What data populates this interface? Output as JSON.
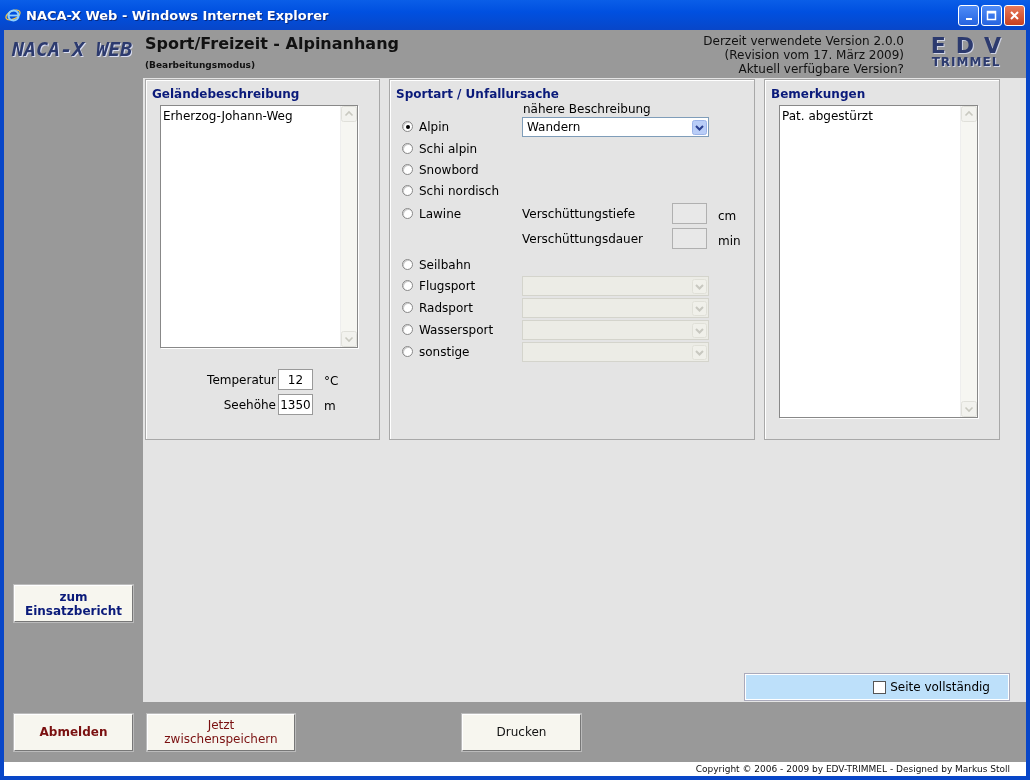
{
  "window": {
    "title": "NACA-X Web - Windows Internet Explorer"
  },
  "header": {
    "logo": "NACA-X WEB",
    "title": "Sport/Freizeit - Alpinanhang",
    "subtitle": "(Bearbeitungsmodus)",
    "version_lines": [
      "Derzeit verwendete Version 2.0.0",
      "(Revision vom 17. März 2009)"
    ],
    "version_link": "Aktuell verfügbare Version?",
    "brand_logo": {
      "top": "EDV",
      "bottom": "TRIMMEL"
    }
  },
  "sidebar": {
    "button": "zum Einsatzbericht"
  },
  "terrain": {
    "heading": "Geländebeschreibung",
    "text": "Erherzog-Johann-Weg",
    "fields": [
      {
        "label": "Temperatur",
        "value": "12",
        "unit": "°C"
      },
      {
        "label": "Seehöhe",
        "value": "1350",
        "unit": "m"
      }
    ]
  },
  "sport": {
    "heading": "Sportart / Unfallursache",
    "detail_label": "nähere Beschreibung",
    "options": [
      {
        "label": "Alpin",
        "selected": true,
        "kind": "select",
        "value": "Wandern",
        "disabled": false
      },
      {
        "label": "Schi alpin",
        "selected": false,
        "kind": "plain"
      },
      {
        "label": "Snowbord",
        "selected": false,
        "kind": "plain"
      },
      {
        "label": "Schi nordisch",
        "selected": false,
        "kind": "plain"
      },
      {
        "label": "Lawine",
        "selected": false,
        "kind": "burial",
        "fields": [
          {
            "label": "Verschüttungstiefe",
            "unit": "cm"
          },
          {
            "label": "Verschüttungsdauer",
            "unit": "min"
          }
        ]
      },
      {
        "label": "Seilbahn",
        "selected": false,
        "kind": "plain"
      },
      {
        "label": "Flugsport",
        "selected": false,
        "kind": "select",
        "disabled": true
      },
      {
        "label": "Radsport",
        "selected": false,
        "kind": "select",
        "disabled": true
      },
      {
        "label": "Wassersport",
        "selected": false,
        "kind": "select",
        "disabled": true
      },
      {
        "label": "sonstige",
        "selected": false,
        "kind": "select",
        "disabled": true
      }
    ]
  },
  "remarks": {
    "heading": "Bemerkungen",
    "text": "Pat. abgestürzt"
  },
  "complete": {
    "label": "Seite vollständig",
    "checked": false
  },
  "buttons": [
    {
      "label": "Abmelden",
      "kind": "logout"
    },
    {
      "label": "Jetzt zwischenspeichern",
      "kind": "save"
    },
    {
      "label": "Drucken",
      "kind": "print"
    }
  ],
  "footer": "Copyright © 2006 - 2009 by EDV-TRIMMEL - Designed by Markus Stoll"
}
